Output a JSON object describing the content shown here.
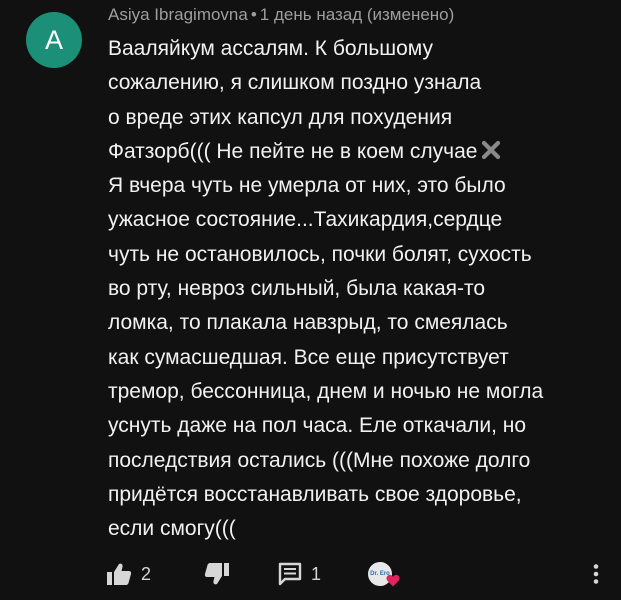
{
  "comment": {
    "avatar_letter": "A",
    "avatar_color": "#1b8f78",
    "author": "Asiya Ibragimovna",
    "separator": "•",
    "timestamp": "1 день назад (изменено)",
    "lines": [
      "Вааляйкум ассалям. К большому",
      "сожалению, я слишком поздно узнала",
      "о вреде этих капсул для похудения",
      "Фатзорб((( Не пейте не в коем случае",
      "Я вчера чуть не умерла от них, это было",
      "ужасное состояние...Тахикардия,сердце",
      "чуть не остановилось, почки болят, сухость",
      "во рту, невроз сильный, была какая-то",
      "ломка, то плакала навзрыд, то смеялась",
      "как сумасшедшая. Все еще присутствует",
      "тремор, бессонница, днем и ночью не могла",
      "уснуть даже на пол часа. Еле откачали, но",
      "последствия остались (((Мне похоже долго",
      "придётся восстанавливать свое здоровье,",
      "если смогу((("
    ],
    "emoji": "cross-mark-icon"
  },
  "actions": {
    "like_count": "2",
    "reply_count": "1",
    "like_icon": "thumbs-up-icon",
    "dislike_icon": "thumbs-down-icon",
    "reply_icon": "comment-icon",
    "more_icon": "more-vertical-icon",
    "creator_heart": {
      "avatar_text": "Dr. Ero",
      "heart_color": "#e0245e"
    }
  }
}
